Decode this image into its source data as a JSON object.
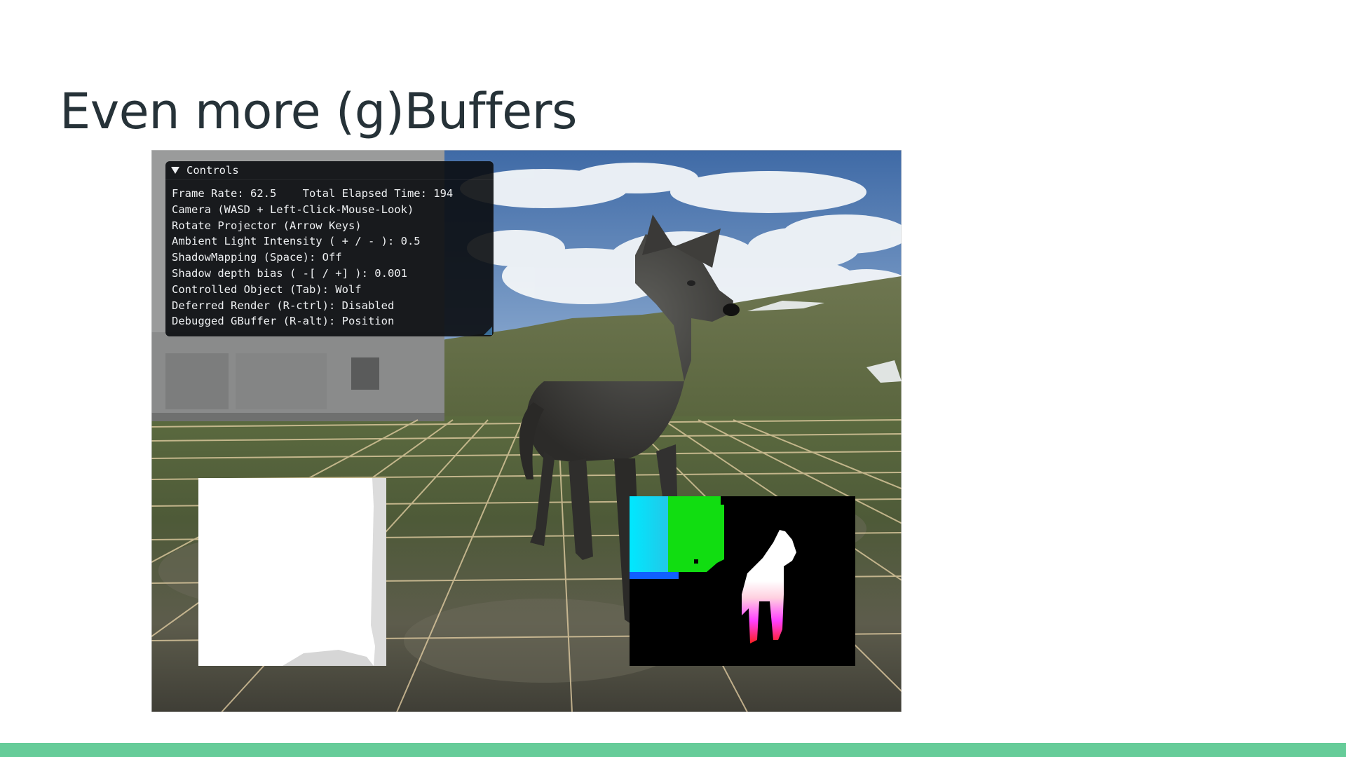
{
  "slide": {
    "title": "Even more (g)Buffers",
    "accent_color": "#66cc99",
    "title_color": "#263238"
  },
  "controls_panel": {
    "header": "Controls",
    "collapse_icon": "triangle-down-icon",
    "lines": [
      "Frame Rate: 62.5    Total Elapsed Time: 194",
      "Camera (WASD + Left-Click-Mouse-Look)",
      "Rotate Projector (Arrow Keys)",
      "Ambient Light Intensity ( + / - ): 0.5",
      "ShadowMapping (Space): Off",
      "Shadow depth bias ( -[ / +] ): 0.001",
      "Controlled Object (Tab): Wolf",
      "Deferred Render (R-ctrl): Disabled",
      "Debugged GBuffer (R-alt): Position"
    ]
  },
  "scene": {
    "subject": "wolf",
    "panels": [
      "gbuffer-depth-preview",
      "gbuffer-position-preview"
    ]
  }
}
